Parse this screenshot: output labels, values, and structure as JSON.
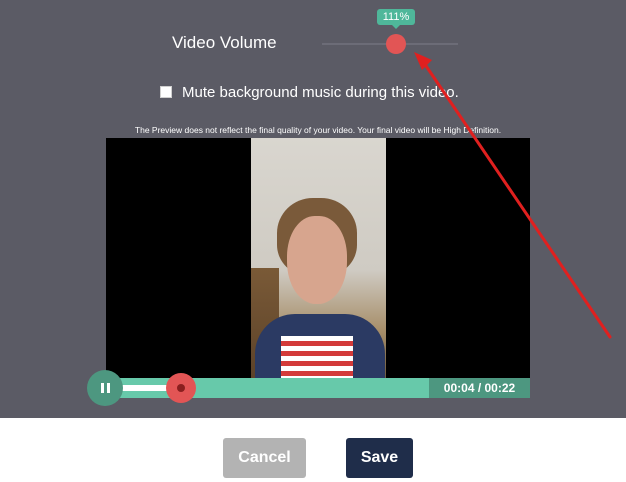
{
  "volume": {
    "label": "Video Volume",
    "tooltip": "111%"
  },
  "mute": {
    "label": "Mute background music during this video.",
    "checked": false
  },
  "preview_note": "The Preview does not reflect the final quality of your video. Your final video will be High Definition.",
  "player": {
    "time_display": "00:04 / 00:22",
    "progress_fraction": 0.18,
    "state": "playing"
  },
  "buttons": {
    "cancel": "Cancel",
    "save": "Save"
  },
  "colors": {
    "panel_bg": "#5b5b65",
    "accent_green": "#67c9aa",
    "dark_green": "#4d9780",
    "thumb_red": "#e25555",
    "save_bg": "#1f2d4a",
    "cancel_bg": "#b3b3b3",
    "annotation_arrow": "#e0201f"
  },
  "icons": {
    "pause": "pause-icon",
    "checkbox": "checkbox-icon"
  }
}
